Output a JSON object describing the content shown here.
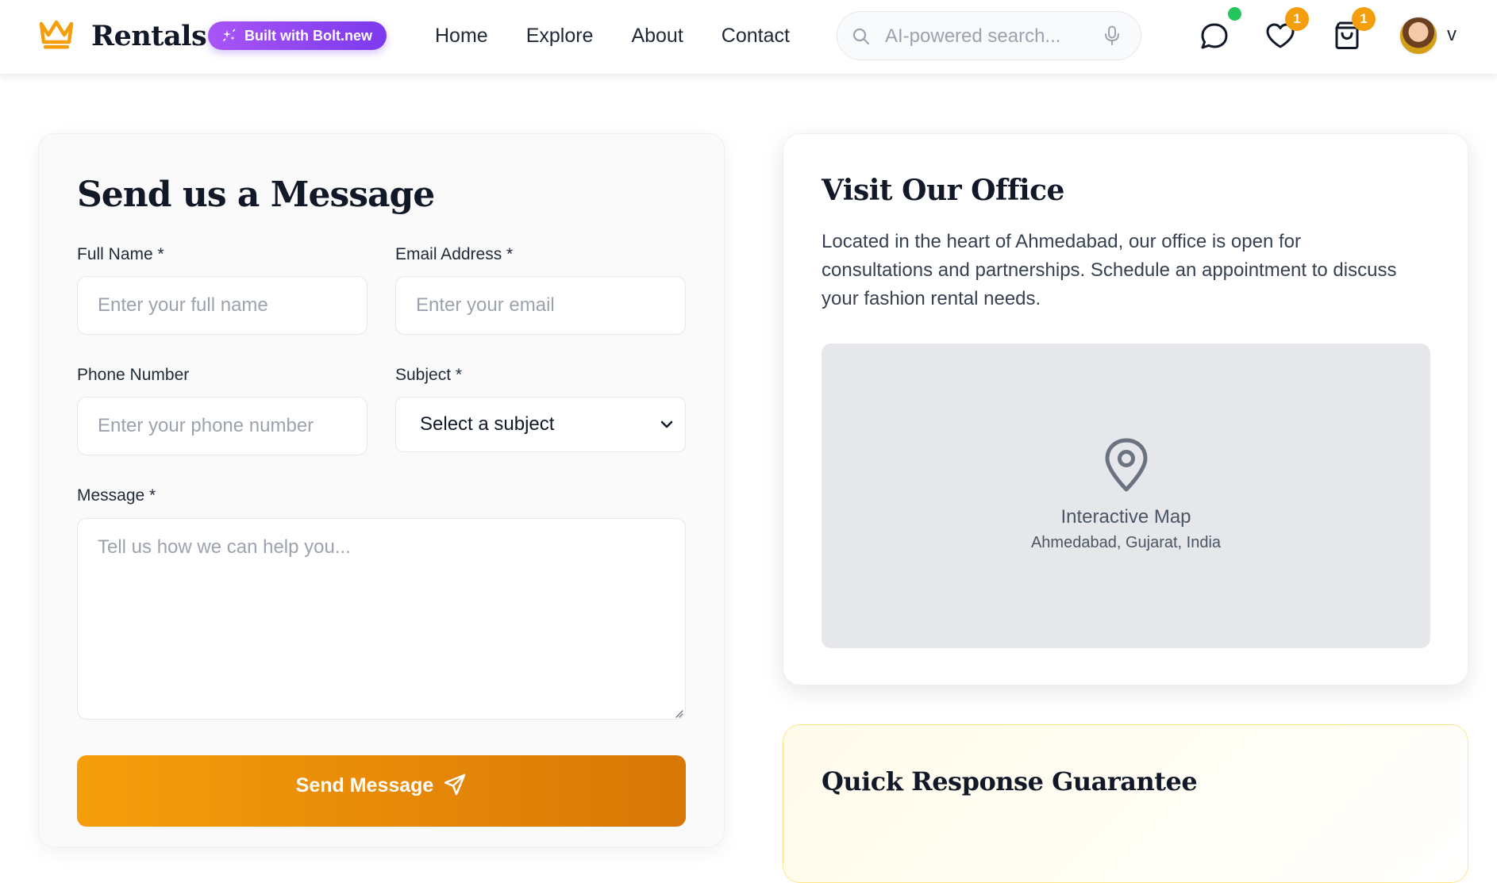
{
  "header": {
    "brand": "Rentals",
    "badge_label": "Built with Bolt.new",
    "nav": [
      "Home",
      "Explore",
      "About",
      "Contact"
    ],
    "search_placeholder": "AI-powered search...",
    "wishlist_count": "1",
    "cart_count": "1",
    "user_initial": "v",
    "colors": {
      "accent": "#f59e0b",
      "badge": "#8b5cf6",
      "online": "#22c55e"
    },
    "icons": [
      "crown-icon",
      "sparkle-icon",
      "search-icon",
      "microphone-icon",
      "chat-icon",
      "heart-icon",
      "shopping-bag-icon"
    ]
  },
  "contact_form": {
    "title": "Send us a Message",
    "full_name": {
      "label": "Full Name *",
      "placeholder": "Enter your full name",
      "value": ""
    },
    "email": {
      "label": "Email Address *",
      "placeholder": "Enter your email",
      "value": ""
    },
    "phone": {
      "label": "Phone Number",
      "placeholder": "Enter your phone number",
      "value": ""
    },
    "subject": {
      "label": "Subject *",
      "selected": "Select a subject"
    },
    "message": {
      "label": "Message *",
      "placeholder": "Tell us how we can help you...",
      "value": ""
    },
    "submit_label": "Send Message",
    "submit_icon": "send-icon"
  },
  "office": {
    "title": "Visit Our Office",
    "description": "Located in the heart of Ahmedabad, our office is open for consultations and partnerships. Schedule an appointment to discuss your fashion rental needs.",
    "map_title": "Interactive Map",
    "map_location": "Ahmedabad, Gujarat, India",
    "map_icon": "map-pin-icon"
  },
  "quick_response": {
    "title": "Quick Response Guarantee"
  }
}
